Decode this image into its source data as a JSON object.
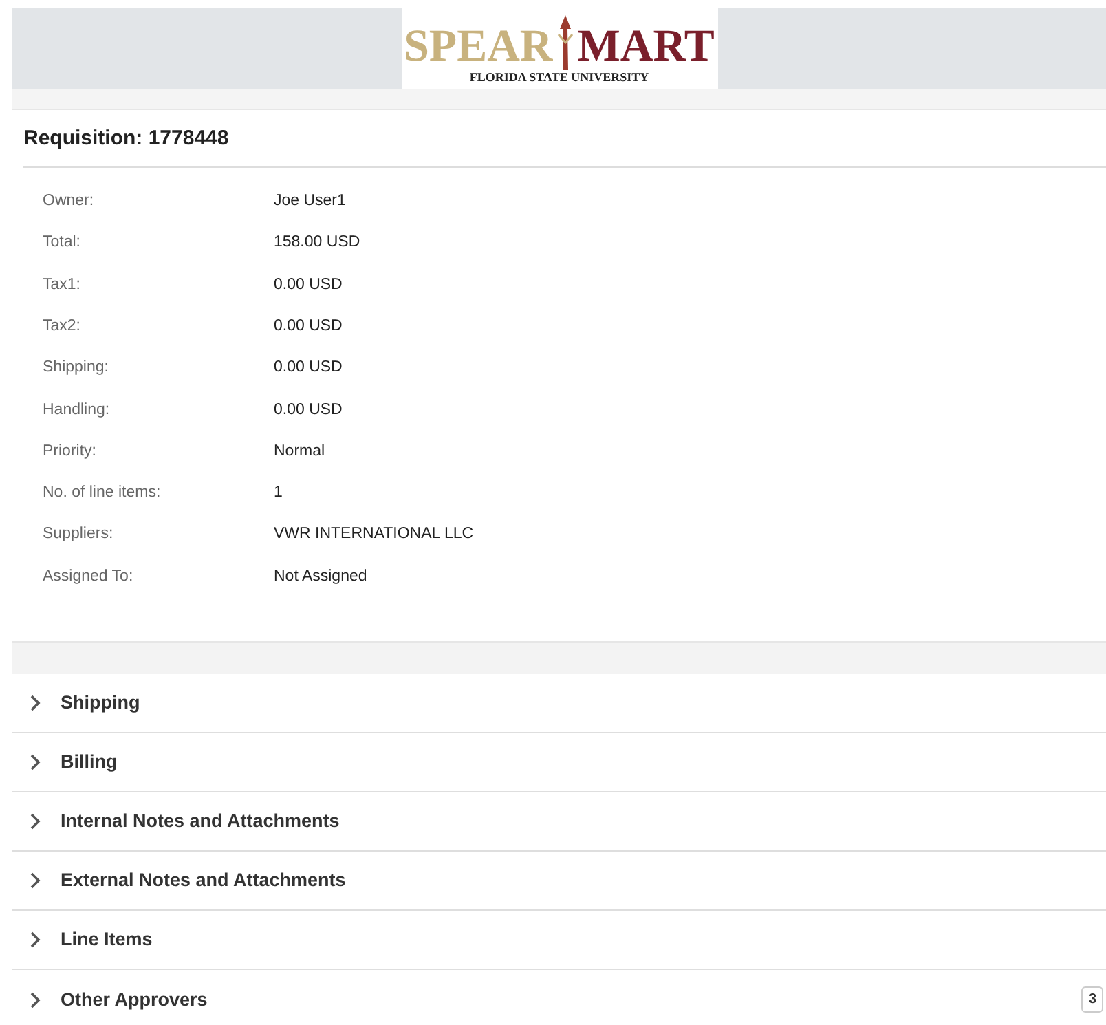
{
  "logo": {
    "word_left": "SPEAR",
    "word_right": "MART",
    "subtitle": "FLORIDA STATE UNIVERSITY"
  },
  "title": "Requisition: 1778448",
  "details": [
    {
      "label": "Owner:",
      "value": "Joe User1"
    },
    {
      "label": "Total:",
      "value": "158.00 USD"
    },
    {
      "label": "Tax1:",
      "value": "0.00 USD"
    },
    {
      "label": "Tax2:",
      "value": "0.00 USD"
    },
    {
      "label": "Shipping:",
      "value": "0.00 USD"
    },
    {
      "label": "Handling:",
      "value": "0.00 USD"
    },
    {
      "label": "Priority:",
      "value": "Normal"
    },
    {
      "label": "No. of line items:",
      "value": "1"
    },
    {
      "label": "Suppliers:",
      "value": "VWR INTERNATIONAL LLC"
    },
    {
      "label": "Assigned To:",
      "value": "Not Assigned"
    }
  ],
  "sections": [
    {
      "label": "Shipping",
      "expanded": false
    },
    {
      "label": "Billing",
      "expanded": false
    },
    {
      "label": "Internal Notes and Attachments",
      "expanded": false
    },
    {
      "label": "External Notes and Attachments",
      "expanded": false
    },
    {
      "label": "Line Items",
      "expanded": false
    },
    {
      "label": "Other Approvers",
      "expanded": false,
      "count": "3"
    }
  ]
}
